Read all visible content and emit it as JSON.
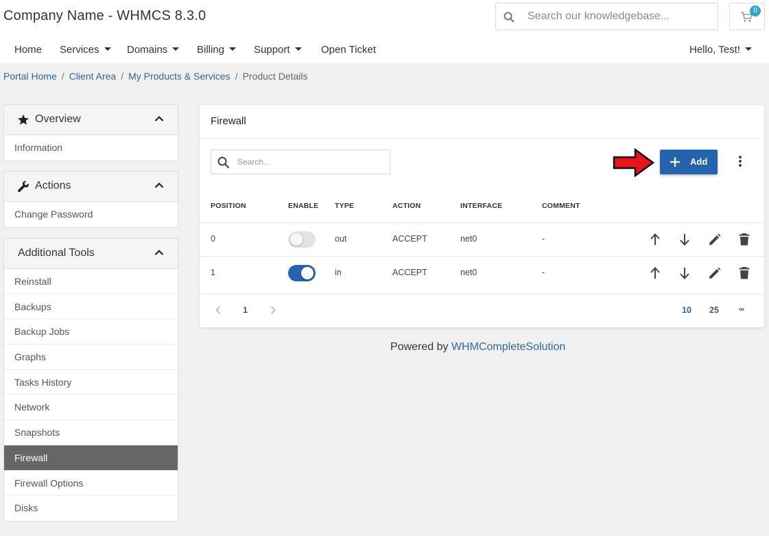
{
  "header": {
    "brand": "Company Name - WHMCS 8.3.0",
    "search_placeholder": "Search our knowledgebase...",
    "cart_count": "0"
  },
  "nav": {
    "home": "Home",
    "services": "Services",
    "domains": "Domains",
    "billing": "Billing",
    "support": "Support",
    "open_ticket": "Open Ticket",
    "user": "Hello, Test!"
  },
  "breadcrumb": {
    "items": [
      "Portal Home",
      "Client Area",
      "My Products & Services"
    ],
    "current": "Product Details"
  },
  "sidebar": {
    "overview": {
      "title": "Overview",
      "items": [
        "Information"
      ]
    },
    "actions": {
      "title": "Actions",
      "items": [
        "Change Password"
      ]
    },
    "tools": {
      "title": "Additional Tools",
      "items": [
        "Reinstall",
        "Backups",
        "Backup Jobs",
        "Graphs",
        "Tasks History",
        "Network",
        "Snapshots",
        "Firewall",
        "Firewall Options",
        "Disks"
      ],
      "active": "Firewall"
    }
  },
  "firewall": {
    "title": "Firewall",
    "search_placeholder": "Search...",
    "add_label": "Add",
    "columns": [
      "POSITION",
      "ENABLE",
      "TYPE",
      "ACTION",
      "INTERFACE",
      "COMMENT"
    ],
    "rows": [
      {
        "position": "0",
        "enabled": false,
        "type": "out",
        "action": "ACCEPT",
        "interface": "net0",
        "comment": "-"
      },
      {
        "position": "1",
        "enabled": true,
        "type": "in",
        "action": "ACCEPT",
        "interface": "net0",
        "comment": "-"
      }
    ],
    "pagination": {
      "current_page": "1",
      "page_sizes": [
        "10",
        "25",
        "∞"
      ]
    }
  },
  "footer": {
    "prefix": "Powered by",
    "link": "WHMCompleteSolution"
  },
  "colors": {
    "primary": "#2563ad",
    "link": "#336699",
    "active_sidebar": "#666666",
    "badge": "#35a3c8",
    "arrow": "#e8141b"
  }
}
